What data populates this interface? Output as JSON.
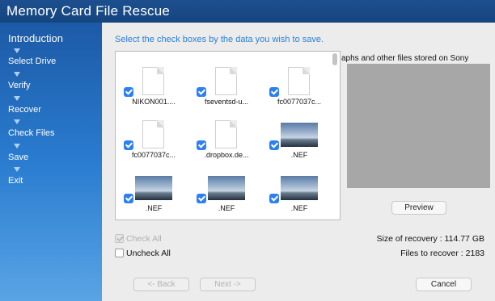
{
  "app": {
    "title": "Memory Card File Rescue"
  },
  "sidebar": {
    "steps": [
      {
        "label": "Introduction",
        "current": true
      },
      {
        "label": "Select Drive"
      },
      {
        "label": "Verify"
      },
      {
        "label": "Recover"
      },
      {
        "label": "Check Files"
      },
      {
        "label": "Save"
      },
      {
        "label": "Exit"
      }
    ]
  },
  "main": {
    "instruction": "Select the check boxes by the data you wish to save.",
    "files": [
      {
        "name": "NIKON001....",
        "kind": "document-icon",
        "checked": true
      },
      {
        "name": "fseventsd-u...",
        "kind": "document-icon",
        "checked": true
      },
      {
        "name": "fc0077037c...",
        "kind": "document-icon",
        "checked": true
      },
      {
        "name": "fc0077037c...",
        "kind": "document-icon",
        "checked": true
      },
      {
        "name": ".dropbox.de...",
        "kind": "document-icon",
        "checked": true
      },
      {
        "name": ".NEF",
        "kind": "photo-thumbnail",
        "checked": true
      },
      {
        "name": ".NEF",
        "kind": "photo-thumbnail",
        "checked": true
      },
      {
        "name": ".NEF",
        "kind": "photo-thumbnail",
        "checked": true
      },
      {
        "name": ".NEF",
        "kind": "photo-thumbnail",
        "checked": true
      }
    ],
    "preview_caption": "aphs and other files stored on Sony",
    "preview_button": "Preview",
    "check_all_label": "Check All",
    "uncheck_all_label": "Uncheck All",
    "size_of_recovery": "Size of recovery : 114.77 GB",
    "files_to_recover": "Files to recover : 2183",
    "back_button": "<- Back",
    "next_button": "Next ->",
    "cancel_button": "Cancel"
  },
  "colors": {
    "title_bar": "#1a4a8a",
    "sidebar_top": "#1c5aa6",
    "sidebar_bottom": "#58a4e4",
    "accent_text": "#2a7fd6",
    "checkbox": "#2d7ff2"
  }
}
